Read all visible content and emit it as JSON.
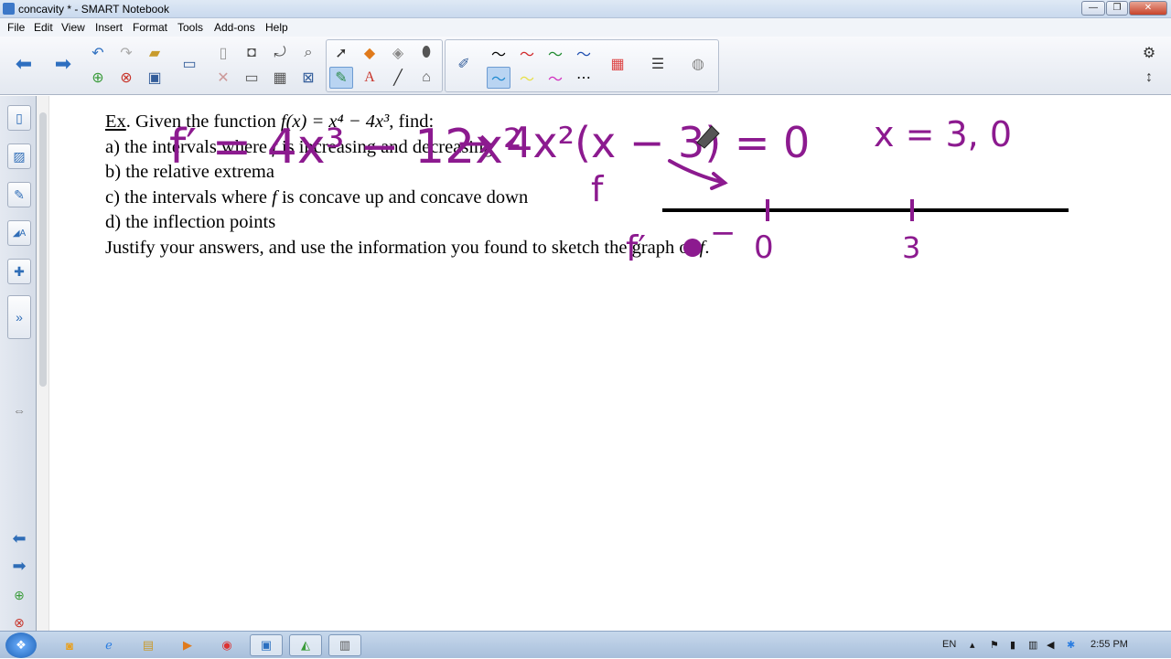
{
  "window": {
    "title": "concavity * - SMART Notebook"
  },
  "menu": [
    "File",
    "Edit",
    "View",
    "Insert",
    "Format",
    "Tools",
    "Add-ons",
    "Help"
  ],
  "problem": {
    "ex_label": "Ex",
    "given": ". Given the function ",
    "function_text": "f(x) = x⁴ − 4x³",
    "find": ", find:",
    "a_pre": "a) the intervals where ",
    "a_var": "f",
    "a_post": " is increasing and decreasing",
    "b": "b) the relative extrema",
    "c_pre": "c) the intervals where ",
    "c_var": "f",
    "c_post": " is concave up and concave down",
    "d": "d) the inflection points",
    "justify": "Justify your answers, and use the information you found to sketch the graph of ",
    "justify_var": "f",
    "justify_end": "."
  },
  "ink_notes": {
    "derivative": "f′ = 4x³ − 12x²",
    "factored": "→ 4x²(x − 3) = 0",
    "roots": "x = 3, 0",
    "f_label": "f",
    "fprime_label": "f′",
    "sign": "−",
    "tick_zero": "0",
    "tick_three": "3"
  },
  "taskbar": {
    "language": "EN",
    "time": "2:55 PM"
  },
  "colors": {
    "ink": "#8c1a8f",
    "titlebar": "#c9d9ee",
    "taskbar": "#a8bfdb"
  }
}
